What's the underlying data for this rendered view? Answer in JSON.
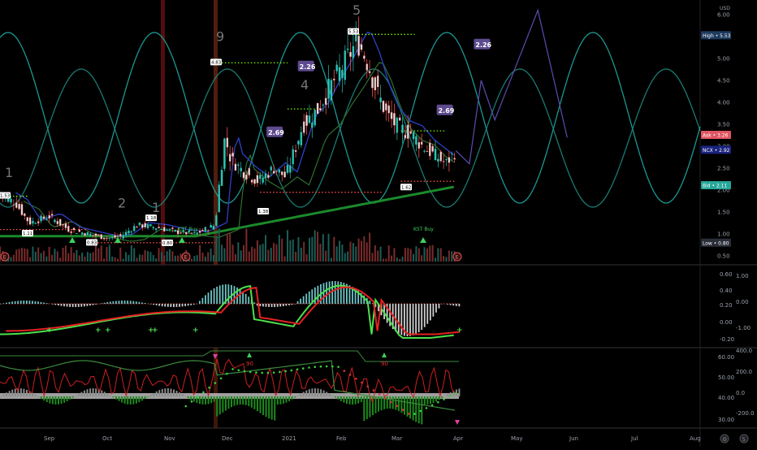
{
  "chart_data": {
    "type": "candlestick",
    "currency_label": "USD",
    "x_tick_labels": [
      "Sep",
      "Oct",
      "Nov",
      "Dec",
      "2021",
      "Feb",
      "Mar",
      "Apr",
      "May",
      "Jun",
      "Jul",
      "Aug"
    ],
    "main_panel": {
      "ylim": [
        0.5,
        6.2
      ],
      "y_ticks": [
        "6.00",
        "5.50",
        "5.00",
        "4.50",
        "4.00",
        "3.50",
        "3.00",
        "2.50",
        "2.00",
        "1.50",
        "1.00",
        "0.50"
      ],
      "price_tags": [
        {
          "label": "High",
          "value": "5.53",
          "color": "#1e3a5f"
        },
        {
          "label": "Ask",
          "value": "3.26",
          "color": "#e05561"
        },
        {
          "label": "NCX",
          "value": "2.92",
          "color": "#1a237e"
        },
        {
          "label": "Bid",
          "value": "2.11",
          "color": "#26a69a"
        },
        {
          "label": "Low",
          "value": "0.80",
          "color": "#2a2e39"
        }
      ],
      "wave_labels": [
        {
          "text": "1",
          "x": "Aug",
          "y": 2.3
        },
        {
          "text": "2",
          "x": "Sep-late",
          "y": 1.6
        },
        {
          "text": "1",
          "x": "Oct-late",
          "y": 1.5
        },
        {
          "text": "9",
          "x": "Nov-late",
          "y": 5.4
        },
        {
          "text": "4",
          "x": "Jan-early",
          "y": 4.3
        },
        {
          "text": "5",
          "x": "Feb-early",
          "y": 6.0
        }
      ],
      "price_markers": [
        {
          "text": "1.53",
          "y": 1.86
        },
        {
          "text": "1.11",
          "y": 1.0
        },
        {
          "text": "0.83",
          "y": 0.79
        },
        {
          "text": "1.18",
          "y": 1.35
        },
        {
          "text": "0.80",
          "y": 0.78
        },
        {
          "text": "4.83",
          "y": 4.9
        },
        {
          "text": "1.38",
          "y": 1.5
        },
        {
          "text": "5.53",
          "y": 5.6
        },
        {
          "text": "1.62",
          "y": 2.05
        }
      ],
      "fib_labels": [
        {
          "text": "2.26",
          "x_day": 156,
          "y": 4.8
        },
        {
          "text": "2.69",
          "x_day": 140,
          "y": 3.3
        },
        {
          "text": "2.26",
          "x_day": 246,
          "y": 5.3
        },
        {
          "text": "2.69",
          "x_day": 227,
          "y": 3.8
        }
      ],
      "signal_labels": [
        "KST Buy",
        "KST Buy"
      ],
      "event_markers": [
        "E",
        "E",
        "E"
      ]
    },
    "panel_2": {
      "left_ticks": [
        "0.60",
        "0.40",
        "0.20",
        "0.00",
        "-0.20"
      ],
      "right_ticks": [
        "1.00",
        "0.00",
        "-1.00"
      ]
    },
    "panel_3": {
      "left_ticks": [
        "60.00",
        "50.00",
        "40.00",
        "30.00"
      ],
      "right_ticks": [
        "400.0",
        "200.0",
        "0.0",
        "-200.0"
      ],
      "markers": [
        "90",
        "90"
      ]
    }
  }
}
